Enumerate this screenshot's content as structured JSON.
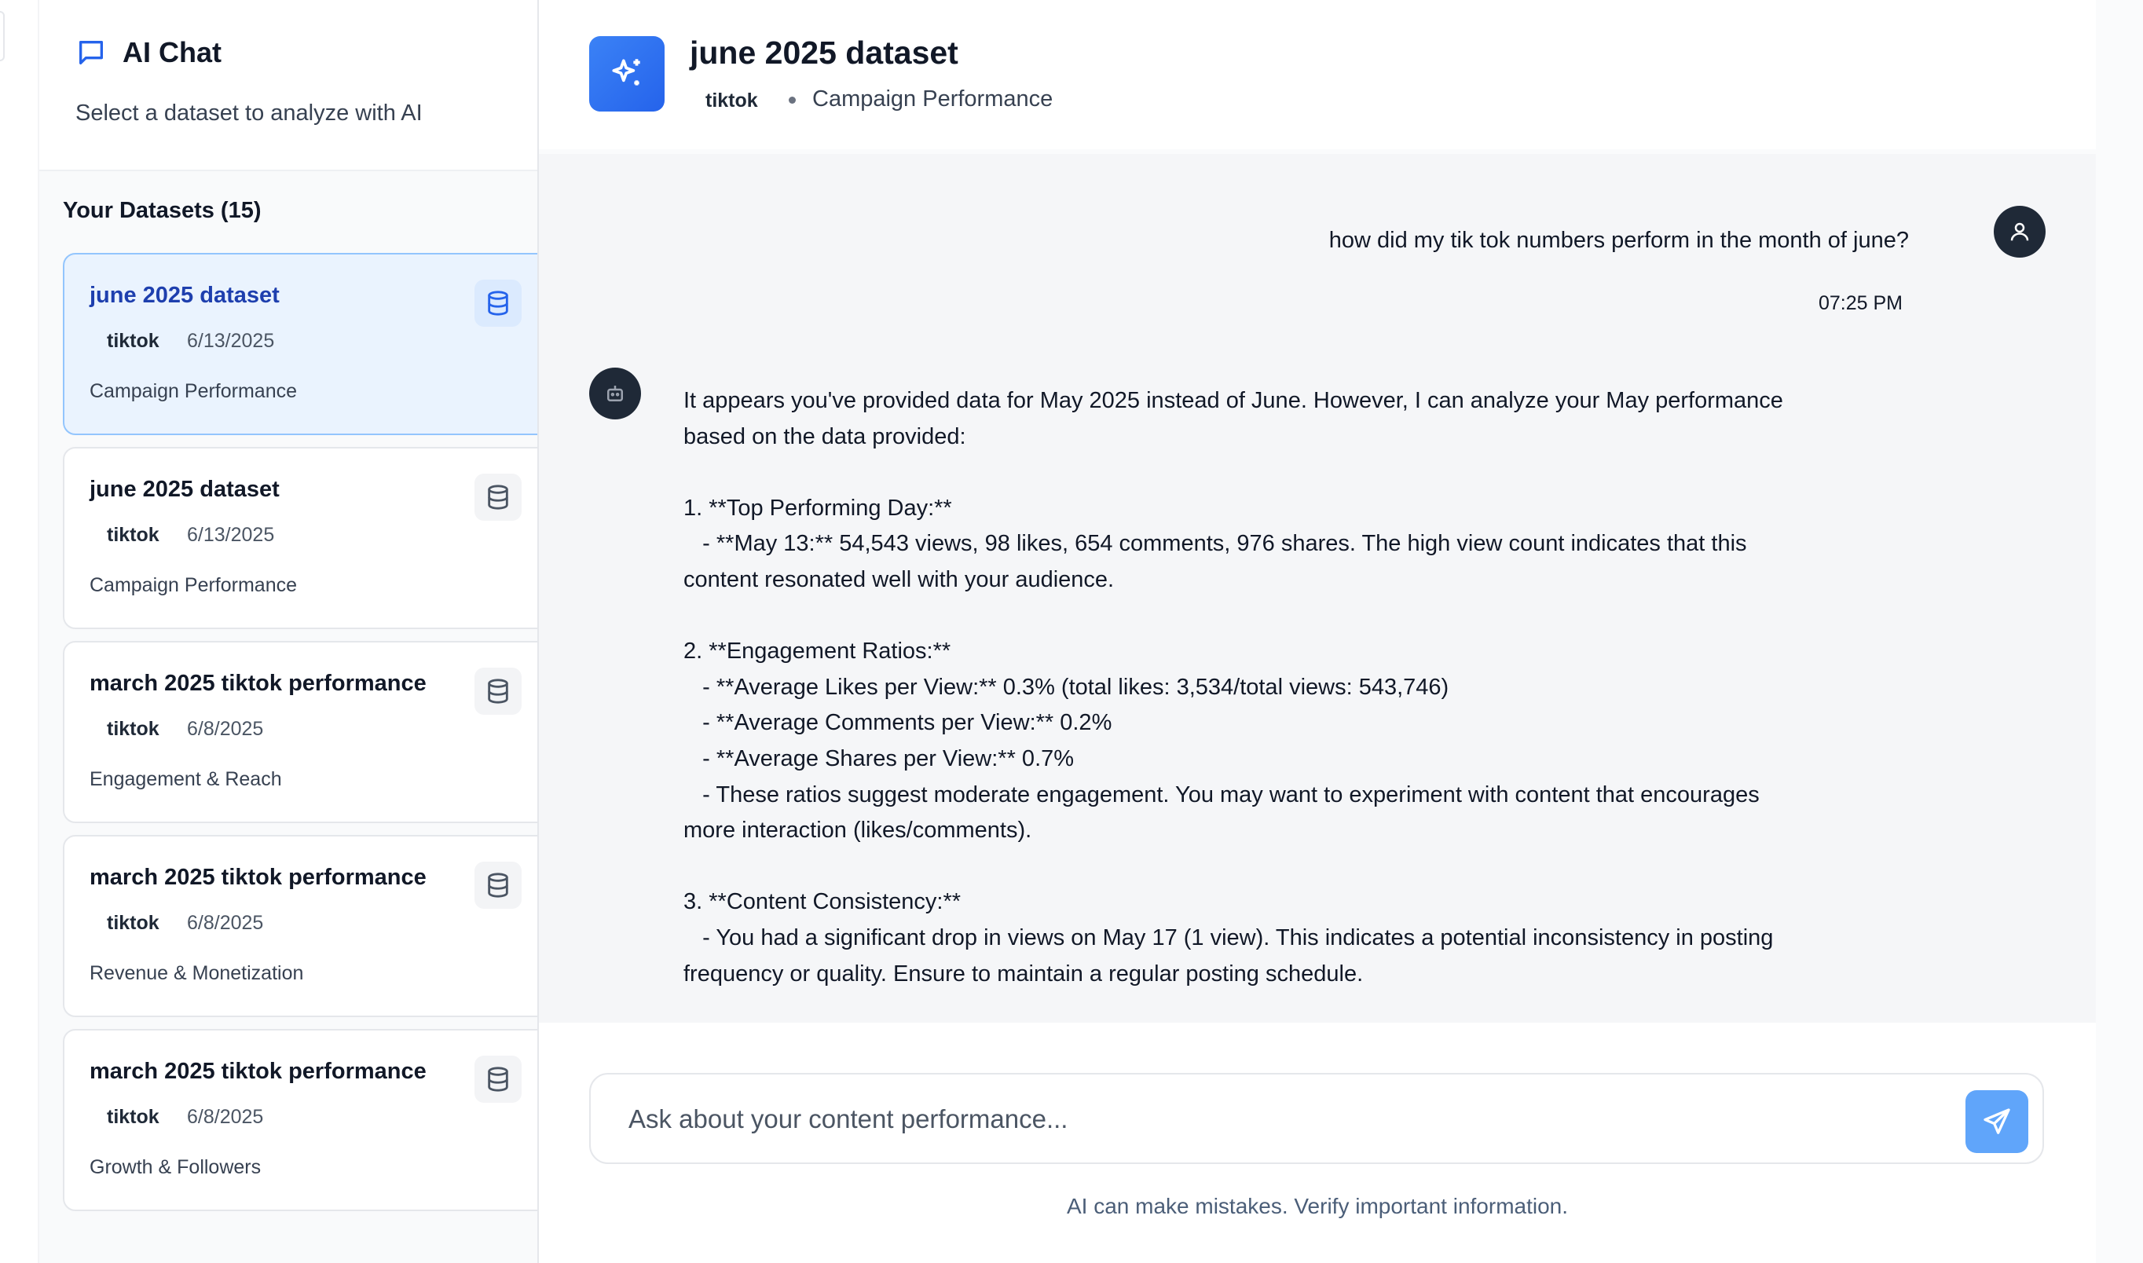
{
  "sidebar": {
    "title": "AI Chat",
    "subtitle": "Select a dataset to analyze with AI",
    "datasets_label": "Your Datasets (15)",
    "datasets": [
      {
        "name": "june 2025 dataset",
        "platform": "tiktok",
        "date": "6/13/2025",
        "category": "Campaign Performance",
        "active": true
      },
      {
        "name": "june 2025 dataset",
        "platform": "tiktok",
        "date": "6/13/2025",
        "category": "Campaign Performance",
        "active": false
      },
      {
        "name": "march 2025 tiktok performance",
        "platform": "tiktok",
        "date": "6/8/2025",
        "category": "Engagement & Reach",
        "active": false
      },
      {
        "name": "march 2025 tiktok performance",
        "platform": "tiktok",
        "date": "6/8/2025",
        "category": "Revenue & Monetization",
        "active": false
      },
      {
        "name": "march 2025 tiktok performance",
        "platform": "tiktok",
        "date": "6/8/2025",
        "category": "Growth & Followers",
        "active": false
      }
    ]
  },
  "chat_header": {
    "title": "june 2025 dataset",
    "platform": "tiktok",
    "category": "Campaign Performance"
  },
  "messages": {
    "user": {
      "text": "how did my tik tok numbers perform in the month of june?",
      "time": "07:25 PM"
    },
    "assistant": {
      "text": "It appears you've provided data for May 2025 instead of June. However, I can analyze your May performance based on the data provided:\n\n1. **Top Performing Day:**\n   - **May 13:** 54,543 views, 98 likes, 654 comments, 976 shares. The high view count indicates that this content resonated well with your audience.\n\n2. **Engagement Ratios:**\n   - **Average Likes per View:** 0.3% (total likes: 3,534/total views: 543,746)\n   - **Average Comments per View:** 0.2%\n   - **Average Shares per View:** 0.7%\n   - These ratios suggest moderate engagement. You may want to experiment with content that encourages more interaction (likes/comments).\n\n3. **Content Consistency:**\n   - You had a significant drop in views on May 17 (1 view). This indicates a potential inconsistency in posting frequency or quality. Ensure to maintain a regular posting schedule."
    }
  },
  "input": {
    "placeholder": "Ask about your content performance...",
    "value": ""
  },
  "disclaimer": "AI can make mistakes. Verify important information.",
  "icons": {
    "sidebar_title": "chat-bubble-icon",
    "dataset": "database-icon",
    "header": "sparkles-icon",
    "user_avatar": "user-icon",
    "bot_avatar": "bot-icon",
    "send": "send-icon"
  },
  "colors": {
    "accent": "#2563eb",
    "active_card_bg": "#eaf3fe",
    "active_card_border": "#93c5fd",
    "send_button": "#60a5fa",
    "avatar_bg": "#1f2937"
  }
}
